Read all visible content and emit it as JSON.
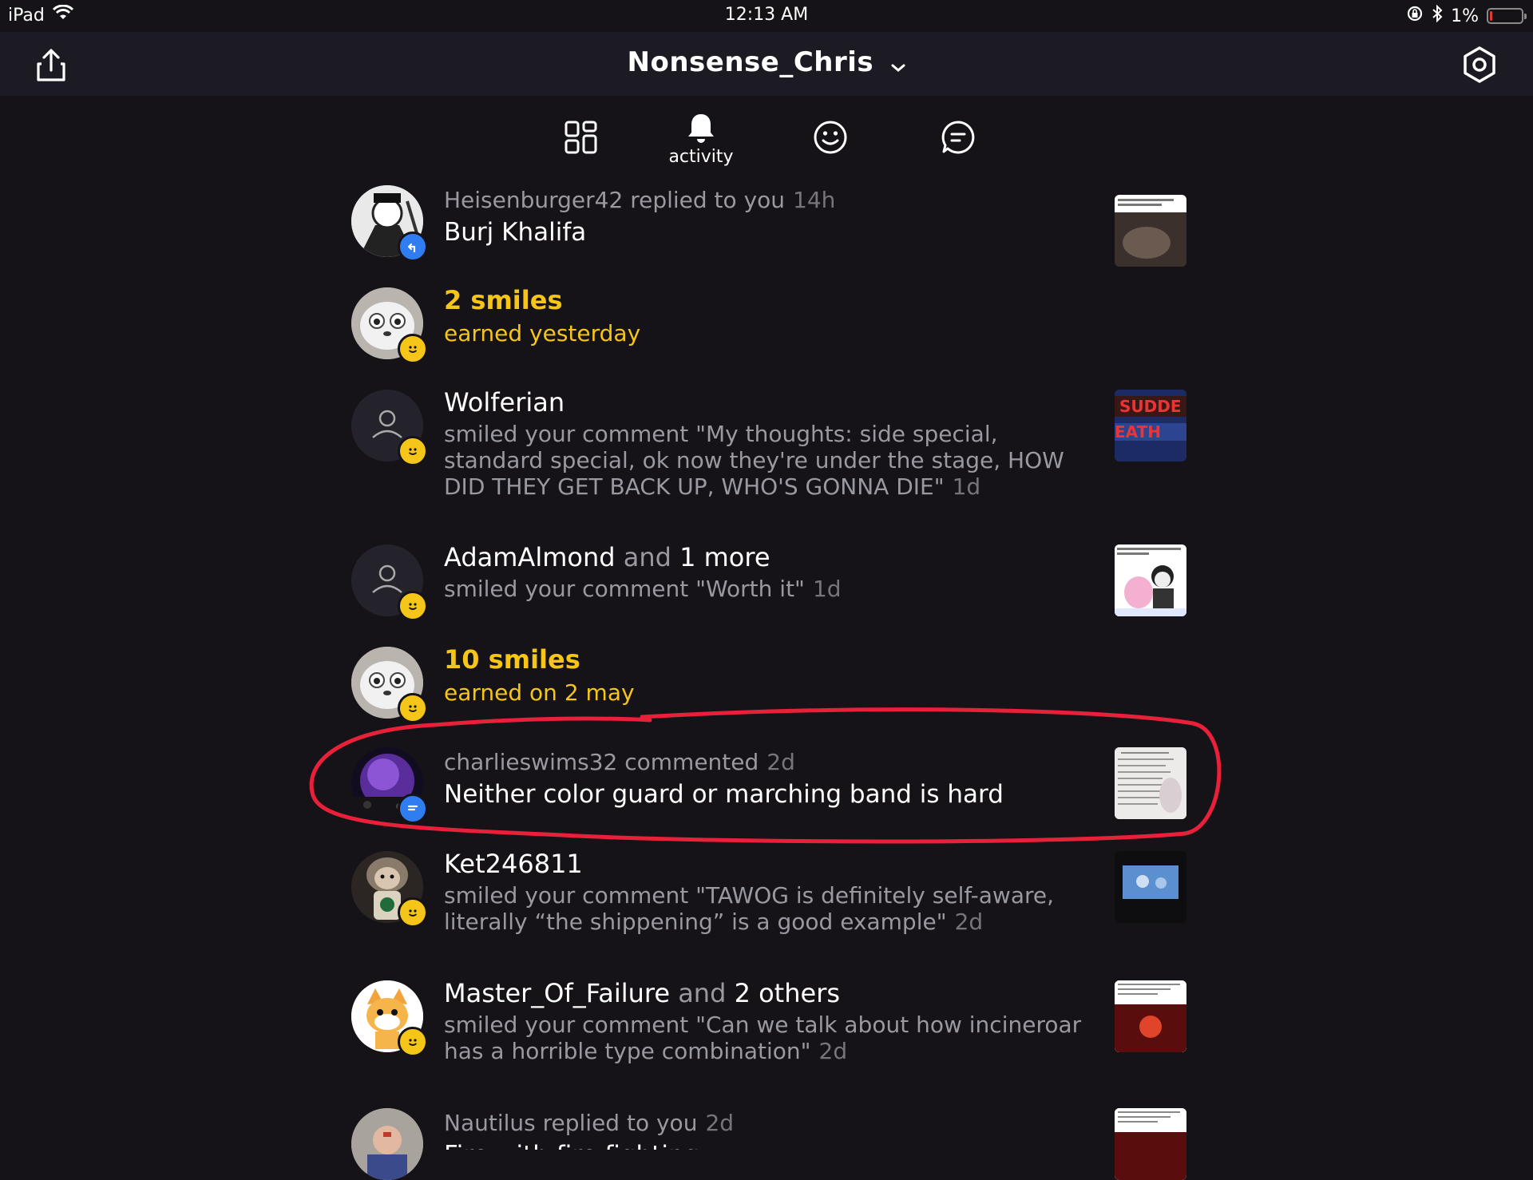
{
  "status_bar": {
    "device": "iPad",
    "time": "12:13 AM",
    "battery_percent": "1%",
    "battery_level": 0.01
  },
  "header": {
    "title": "Nonsense_Chris"
  },
  "tabs": [
    {
      "icon": "grid-icon",
      "label": ""
    },
    {
      "icon": "bell-icon",
      "label": "activity",
      "active": true
    },
    {
      "icon": "smiley-icon",
      "label": ""
    },
    {
      "icon": "chat-bubble-icon",
      "label": ""
    }
  ],
  "feed": {
    "items": [
      {
        "meta": "Heisenburger42 replied to you",
        "time": "14h",
        "text": "Burj Khalifa"
      },
      {
        "title": "2 smiles",
        "subtitle": "earned yesterday"
      },
      {
        "name": "Wolferian",
        "desc": "smiled your comment \"My thoughts: side special, standard special, ok now they're under the stage, HOW DID THEY GET BACK UP, WHO'S GONNA DIE\"",
        "time": "1d"
      },
      {
        "name": "AdamAlmond",
        "joiner": "and",
        "more": "1 more",
        "desc": "smiled your comment \"Worth it\"",
        "time": "1d"
      },
      {
        "title": "10 smiles",
        "subtitle": "earned on 2 may"
      },
      {
        "meta": "charlieswims32 commented",
        "time": "2d",
        "text": "Neither color guard or marching band is hard"
      },
      {
        "name": "Ket246811",
        "desc": "smiled your comment \"TAWOG is definitely self-aware, literally “the shippening” is a good example\"",
        "time": "2d"
      },
      {
        "name": "Master_Of_Failure",
        "joiner": "and",
        "more": "2 others",
        "desc": "smiled your comment \"Can we talk about how incineroar has a horrible type combination\"",
        "time": "2d"
      },
      {
        "meta": "Nautilus replied to you",
        "time": "2d",
        "text": "Fire with fire fighting"
      }
    ]
  },
  "colors": {
    "background": "#151318",
    "accent_gold": "#f5c518",
    "badge_blue": "#2f7df0",
    "highlight_red": "#e8203a"
  }
}
